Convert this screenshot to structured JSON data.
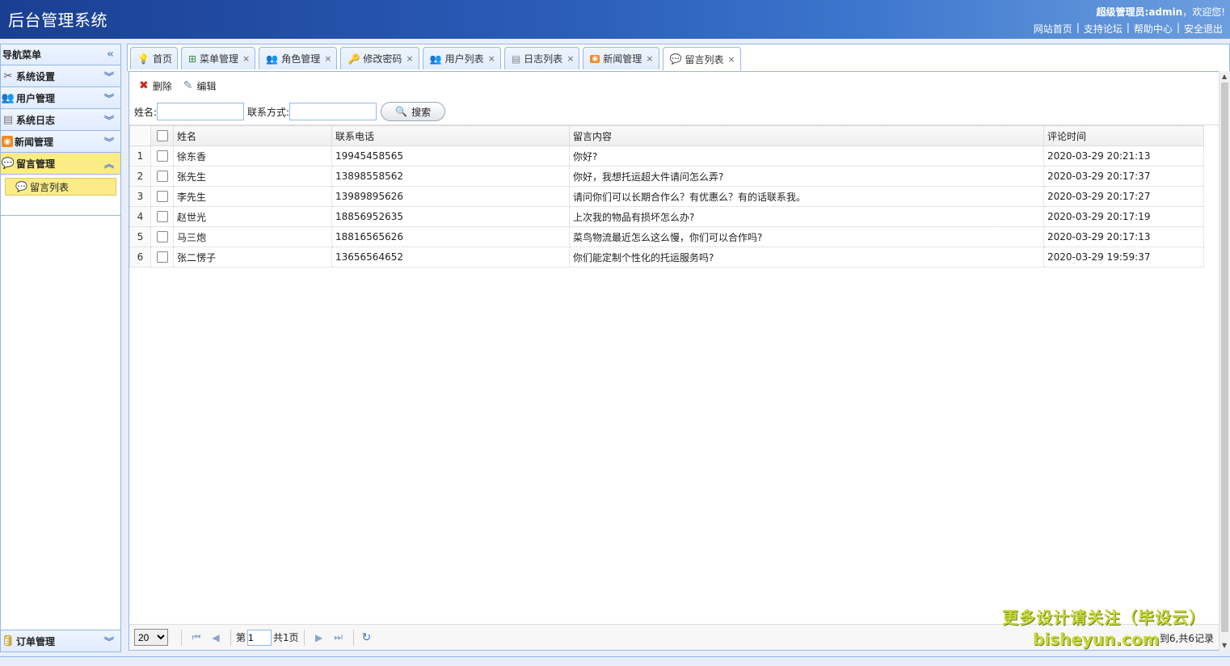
{
  "app": {
    "title": "后台管理系统"
  },
  "header": {
    "welcome_user": "超级管理员:admin",
    "welcome_suffix": "，欢迎您!",
    "links": [
      "网站首页",
      "支持论坛",
      "帮助中心",
      "安全退出"
    ]
  },
  "sidebar": {
    "title": "导航菜单",
    "sections": [
      {
        "label": "系统设置",
        "icon": "tools-icon"
      },
      {
        "label": "用户管理",
        "icon": "users-icon"
      },
      {
        "label": "系统日志",
        "icon": "log-icon"
      },
      {
        "label": "新闻管理",
        "icon": "rss-icon"
      },
      {
        "label": "留言管理",
        "icon": "comment-icon",
        "expanded": true
      }
    ],
    "active_item": "留言列表",
    "bottom_section": "订单管理"
  },
  "tabs": [
    {
      "label": "首页",
      "closable": false
    },
    {
      "label": "菜单管理",
      "closable": true
    },
    {
      "label": "角色管理",
      "closable": true
    },
    {
      "label": "修改密码",
      "closable": true
    },
    {
      "label": "用户列表",
      "closable": true
    },
    {
      "label": "日志列表",
      "closable": true
    },
    {
      "label": "新闻管理",
      "closable": true
    },
    {
      "label": "留言列表",
      "closable": true,
      "active": true
    }
  ],
  "toolbar": {
    "delete_label": "删除",
    "edit_label": "编辑"
  },
  "search": {
    "name_label": "姓名:",
    "name_value": "",
    "contact_label": "联系方式:",
    "contact_value": "",
    "button_label": "搜索"
  },
  "grid": {
    "columns": [
      "姓名",
      "联系电话",
      "留言内容",
      "评论时间"
    ],
    "rows": [
      {
        "no": "1",
        "name": "徐东香",
        "phone": "19945458565",
        "content": "你好?",
        "time": "2020-03-29 20:21:13"
      },
      {
        "no": "2",
        "name": "张先生",
        "phone": "13898558562",
        "content": "你好，我想托运超大件请问怎么弄?",
        "time": "2020-03-29 20:17:37"
      },
      {
        "no": "3",
        "name": "李先生",
        "phone": "13989895626",
        "content": "请问你们可以长期合作么？有优惠么？有的话联系我。",
        "time": "2020-03-29 20:17:27"
      },
      {
        "no": "4",
        "name": "赵世光",
        "phone": "18856952635",
        "content": "上次我的物品有损坏怎么办?",
        "time": "2020-03-29 20:17:19"
      },
      {
        "no": "5",
        "name": "马三炮",
        "phone": "18816565626",
        "content": "菜鸟物流最近怎么这么慢，你们可以合作吗?",
        "time": "2020-03-29 20:17:13"
      },
      {
        "no": "6",
        "name": "张二愣子",
        "phone": "13656564652",
        "content": "你们能定制个性化的托运服务吗?",
        "time": "2020-03-29 19:59:37"
      }
    ]
  },
  "pager": {
    "page_size": "20",
    "page_prefix": "第",
    "page_value": "1",
    "page_suffix": "共1页",
    "info": "到6,共6记录"
  },
  "watermark": {
    "line1": "更多设计请关注（毕设云）",
    "line2": "bisheyun.com"
  }
}
